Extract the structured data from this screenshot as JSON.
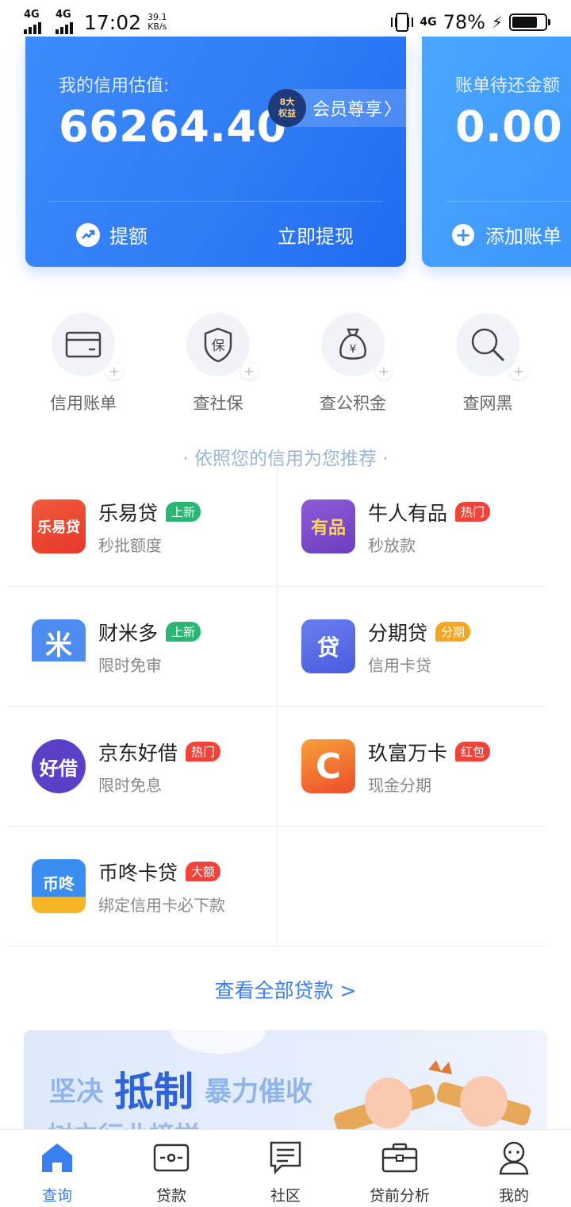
{
  "status_bar": {
    "net1": "4G",
    "net2": "4G",
    "time": "17:02",
    "speed_value": "39.1",
    "speed_unit": "KB/s",
    "net_right": "4G",
    "battery": "78%",
    "battery_level": 0.78
  },
  "credit_card": {
    "label": "我的信用估值:",
    "value": "66264.40",
    "member_badge_line1": "8大",
    "member_badge_line2": "权益",
    "member_text": "会员尊享",
    "raise_label": "提额",
    "withdraw_label": "立即提现"
  },
  "bill_card": {
    "label": "账单待还金额",
    "value": "0.00",
    "add_label": "添加账单"
  },
  "tools": [
    {
      "label": "信用账单",
      "icon": "card-icon"
    },
    {
      "label": "查社保",
      "icon": "shield-icon"
    },
    {
      "label": "查公积金",
      "icon": "money-bag-icon"
    },
    {
      "label": "查网黑",
      "icon": "magnifier-icon"
    }
  ],
  "recommend_title": "· 依照您的信用为您推荐 ·",
  "products": [
    {
      "name": "乐易贷",
      "tag": "上新",
      "tag_color": "#2bb673",
      "sub": "秒批额度",
      "logo_text": "乐易贷",
      "logo_bg": "#ef4a2a"
    },
    {
      "name": "牛人有品",
      "tag": "热门",
      "tag_color": "#f0443a",
      "sub": "秒放款",
      "logo_text": "有品",
      "logo_bg": "#7b4fc9"
    },
    {
      "name": "财米多",
      "tag": "上新",
      "tag_color": "#2bb673",
      "sub": "限时免审",
      "logo_text": "米",
      "logo_bg": "#4a86ea"
    },
    {
      "name": "分期贷",
      "tag": "分期",
      "tag_color": "#f5a623",
      "sub": "信用卡贷",
      "logo_text": "贷",
      "logo_bg": "#5b6ee8"
    },
    {
      "name": "京东好借",
      "tag": "热门",
      "tag_color": "#f0443a",
      "sub": "限时免息",
      "logo_text": "好借",
      "logo_bg": "#5b3fc7"
    },
    {
      "name": "玖富万卡",
      "tag": "红包",
      "tag_color": "#f0443a",
      "sub": "现金分期",
      "logo_text": "C",
      "logo_bg": "#f26b2e"
    },
    {
      "name": "币咚卡贷",
      "tag": "大额",
      "tag_color": "#f0443a",
      "sub": "绑定信用卡必下款",
      "logo_text": "币咚",
      "logo_bg": "#2f80e8"
    }
  ],
  "view_all": "查看全部贷款 >",
  "banner": {
    "light1": "坚决",
    "strong": "抵制",
    "light2": "暴力催收",
    "sub": "树立行业榜样"
  },
  "bottom_nav": [
    {
      "label": "查询",
      "icon": "home-icon",
      "active": true
    },
    {
      "label": "贷款",
      "icon": "loan-icon",
      "active": false
    },
    {
      "label": "社区",
      "icon": "community-icon",
      "active": false
    },
    {
      "label": "贷前分析",
      "icon": "briefcase-icon",
      "active": false
    },
    {
      "label": "我的",
      "icon": "profile-icon",
      "active": false
    }
  ]
}
